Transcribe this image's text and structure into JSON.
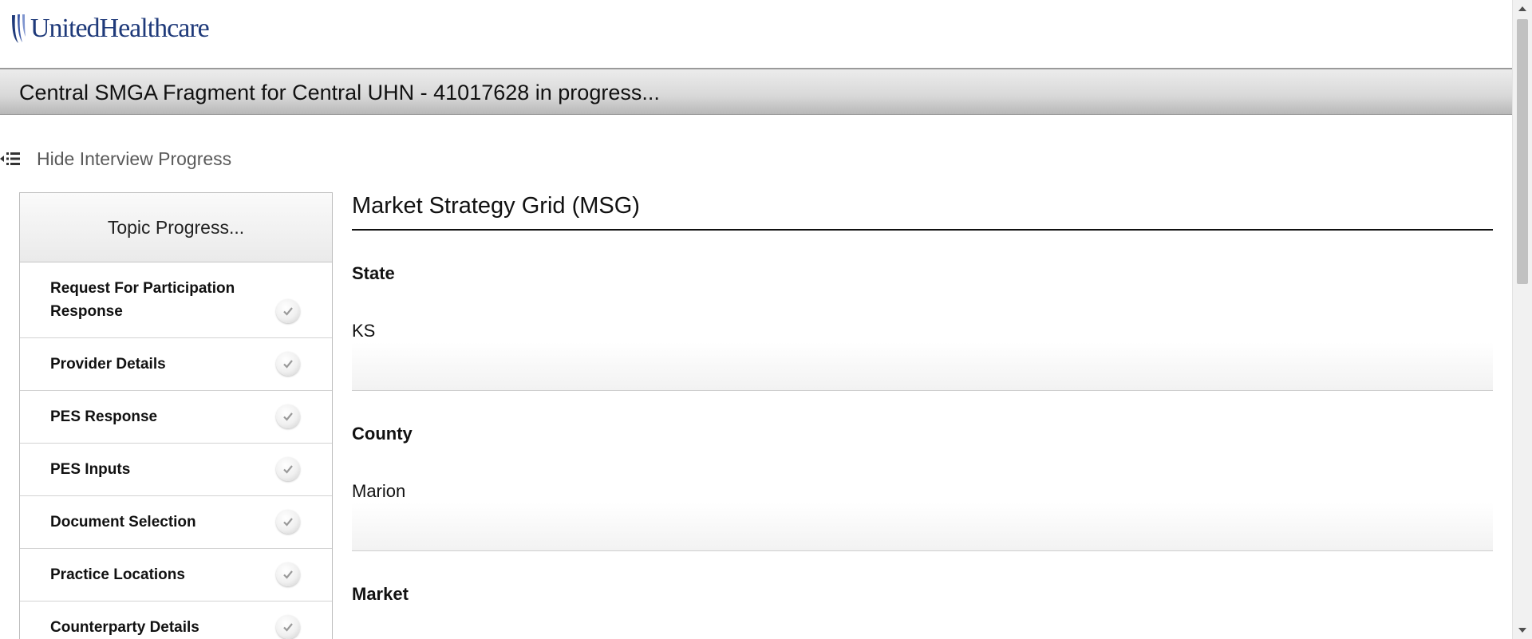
{
  "brand": {
    "logo_text": "UnitedHealthcare",
    "logo_color": "#1f3a7a"
  },
  "titlebar": {
    "title": "Central SMGA Fragment for Central UHN - 41017628 in progress..."
  },
  "toggle": {
    "label": "Hide Interview Progress",
    "icon": "collapse-list-icon"
  },
  "progress": {
    "header": "Topic Progress...",
    "items": [
      {
        "label": "Request For Participation Response",
        "status": "complete"
      },
      {
        "label": "Provider Details",
        "status": "complete"
      },
      {
        "label": "PES Response",
        "status": "complete"
      },
      {
        "label": "PES Inputs",
        "status": "complete"
      },
      {
        "label": "Document Selection",
        "status": "complete"
      },
      {
        "label": "Practice Locations",
        "status": "complete"
      },
      {
        "label": "Counterparty Details",
        "status": "complete"
      }
    ]
  },
  "main": {
    "title": "Market Strategy Grid (MSG)",
    "fields": [
      {
        "label": "State",
        "value": "KS"
      },
      {
        "label": "County",
        "value": "Marion"
      },
      {
        "label": "Market",
        "value": ""
      }
    ]
  }
}
